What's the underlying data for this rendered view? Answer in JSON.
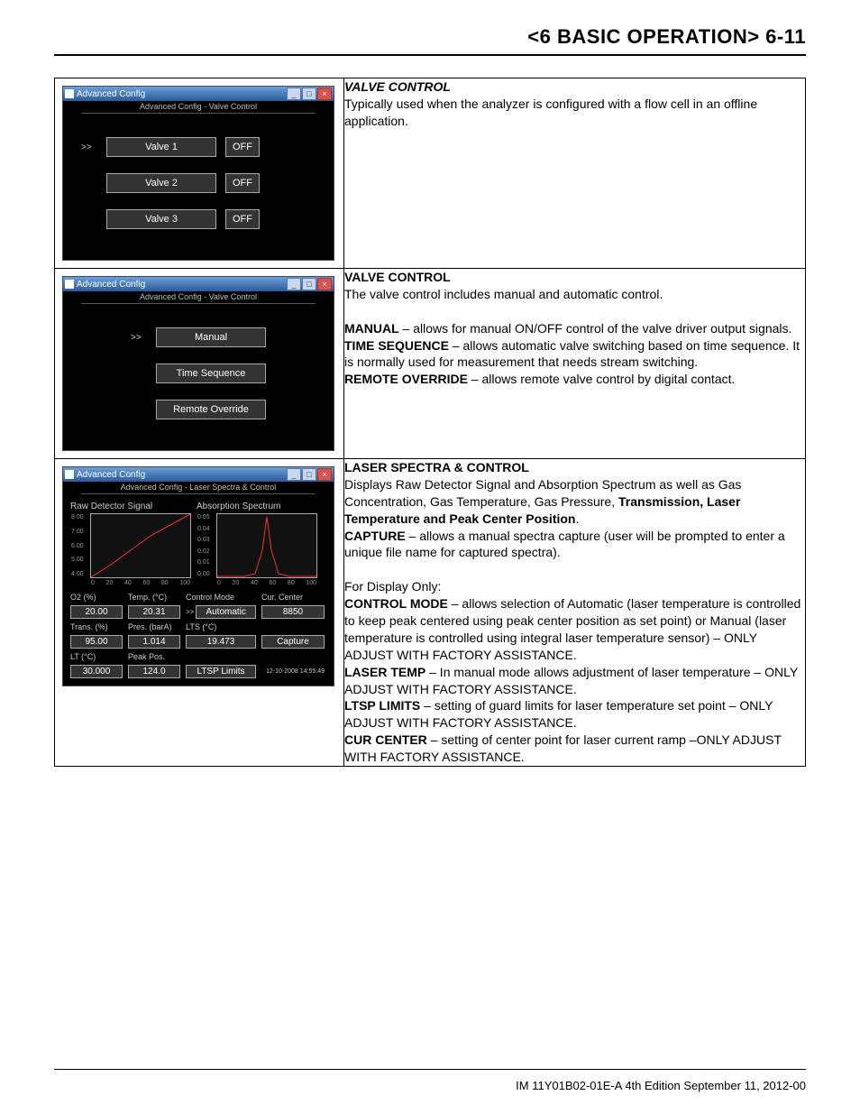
{
  "page_header": "<6 BASIC OPERATION>  6-11",
  "footer": "IM 11Y01B02-01E-A  4th Edition September 11, 2012-00",
  "row1": {
    "shot": {
      "title": "Advanced Config",
      "subtitle": "Advanced Config - Valve Control",
      "valves": [
        {
          "name": "Valve 1",
          "state": "OFF"
        },
        {
          "name": "Valve 2",
          "state": "OFF"
        },
        {
          "name": "Valve 3",
          "state": "OFF"
        }
      ]
    },
    "heading": "VALVE CONTROL",
    "body": "Typically used when the analyzer is configured with a flow cell in an offline application."
  },
  "row2": {
    "shot": {
      "title": "Advanced Config",
      "subtitle": "Advanced Config - Valve Control",
      "buttons": [
        "Manual",
        "Time Sequence",
        "Remote Override"
      ]
    },
    "heading": "VALVE CONTROL",
    "intro": "The valve control includes manual and automatic control.",
    "items": [
      {
        "term": "MANUAL",
        "text": " – allows for manual ON/OFF control of the valve driver output signals."
      },
      {
        "term": "TIME SEQUENCE",
        "text": " – allows automatic valve switching based on time sequence. It is normally used for measurement that needs stream switching."
      },
      {
        "term": "REMOTE OVERRIDE",
        "text": " – allows remote valve control by digital contact."
      }
    ]
  },
  "row3": {
    "shot": {
      "title": "Advanced Config",
      "subtitle": "Advanced Config - Laser Spectra & Control",
      "chart1_label": "Raw Detector Signal",
      "chart2_label": "Absorption Spectrum",
      "fields": {
        "o2_label": "O2 (%)",
        "o2": "20.00",
        "temp_label": "Temp. (°C)",
        "temp": "20.31",
        "cm_label": "Control Mode",
        "cm": "Automatic",
        "cc_label": "Cur. Center",
        "cc": "8850",
        "trans_label": "Trans. (%)",
        "trans": "95.00",
        "pres_label": "Pres. (barA)",
        "pres": "1.014",
        "lts_label": "LTS (°C)",
        "lts": "19.473",
        "capture": "Capture",
        "lt_label": "LT (°C)",
        "lt": "30.000",
        "pk_label": "Peak Pos.",
        "pk": "124.0",
        "ltsp": "LTSP Limits",
        "timestamp": "12-10-2008 14:55:49"
      }
    },
    "heading": "LASER SPECTRA & CONTROL",
    "p1a": "Displays Raw Detector Signal and Absorption Spectrum as well as Gas Concentration, Gas Temperature, Gas Pressure, ",
    "p1b_bold": "Transmission, Laser Temperature and Peak Center Position",
    "p1c": ".",
    "cap_term": "CAPTURE",
    "cap_text": " – allows a manual spectra capture (user will be prompted to enter a unique file name for captured spectra).",
    "disp": "For Display Only:",
    "items": [
      {
        "term": "CONTROL MODE",
        "text": " – allows selection of Automatic (laser temperature is controlled to keep peak centered using peak center position as set point) or Manual (laser temperature is controlled using integral laser temperature sensor) – ONLY ADJUST WITH FACTORY ASSISTANCE."
      },
      {
        "term": "LASER TEMP",
        "text": " – In manual mode allows adjustment of laser temperature – ONLY ADJUST WITH FACTORY ASSISTANCE."
      },
      {
        "term": "LTSP LIMITS",
        "text": " – setting of guard limits for laser temperature set point – ONLY ADJUST WITH FACTORY ASSISTANCE."
      },
      {
        "term": "CUR CENTER",
        "text": " – setting of center point for laser current ramp –ONLY ADJUST WITH FACTORY ASSISTANCE."
      }
    ]
  },
  "chart_data": [
    {
      "type": "line",
      "title": "Raw Detector Signal",
      "xlabel": "",
      "ylabel": "",
      "xlim": [
        0,
        100
      ],
      "ylim": [
        4,
        8
      ],
      "x_ticks": [
        0,
        20,
        40,
        60,
        80,
        100
      ],
      "y_ticks": [
        4.0,
        5.0,
        6.0,
        7.0,
        8.0
      ],
      "series": [
        {
          "name": "signal",
          "x": [
            0,
            20,
            40,
            60,
            80,
            100
          ],
          "values": [
            4.0,
            4.8,
            5.8,
            6.7,
            7.4,
            8.0
          ]
        }
      ]
    },
    {
      "type": "line",
      "title": "Absorption Spectrum",
      "xlabel": "",
      "ylabel": "",
      "xlim": [
        0,
        100
      ],
      "ylim": [
        0,
        0.05
      ],
      "x_ticks": [
        0,
        20,
        40,
        60,
        80,
        100
      ],
      "y_ticks": [
        0.0,
        0.01,
        0.02,
        0.03,
        0.04,
        0.05
      ],
      "series": [
        {
          "name": "absorption",
          "x": [
            0,
            20,
            35,
            45,
            50,
            55,
            65,
            80,
            100
          ],
          "values": [
            0.0,
            0.0,
            0.002,
            0.02,
            0.048,
            0.02,
            0.002,
            0.0,
            0.0
          ]
        }
      ]
    }
  ]
}
